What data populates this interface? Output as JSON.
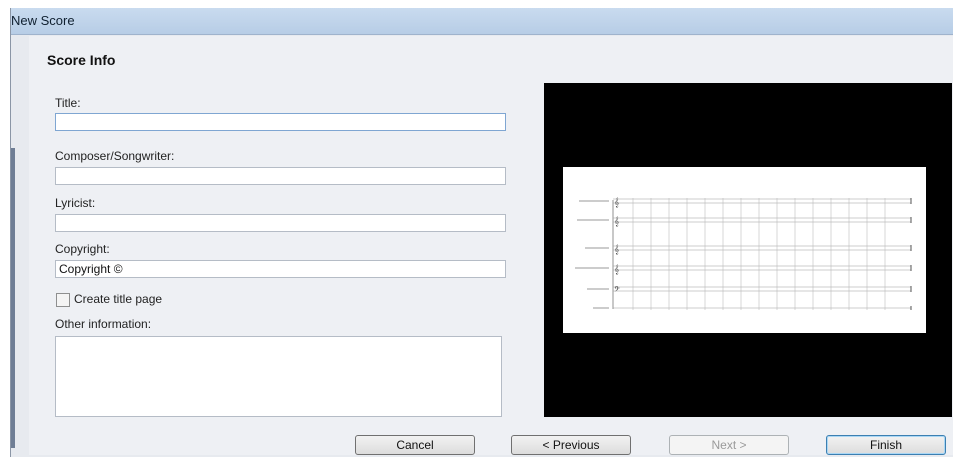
{
  "window": {
    "title": "New Score"
  },
  "section": {
    "title": "Score Info"
  },
  "fields": {
    "title": {
      "label": "Title:",
      "value": ""
    },
    "composer": {
      "label": "Composer/Songwriter:",
      "value": ""
    },
    "lyricist": {
      "label": "Lyricist:",
      "value": ""
    },
    "copyright": {
      "label": "Copyright:",
      "value": "Copyright ©"
    },
    "create_title_page": {
      "label": "Create title page",
      "checked": false
    },
    "other_info": {
      "label": "Other information:",
      "value": ""
    }
  },
  "preview": {
    "staff_count": 6,
    "clefs": [
      "treble",
      "treble",
      "treble",
      "treble",
      "bass",
      "percussion"
    ]
  },
  "buttons": {
    "cancel": "Cancel",
    "previous": "< Previous",
    "next": "Next >",
    "finish": "Finish"
  },
  "colors": {
    "titlebar": "#c9dbef",
    "preview_background": "#000000",
    "default_button_border": "#3c7fb1"
  }
}
